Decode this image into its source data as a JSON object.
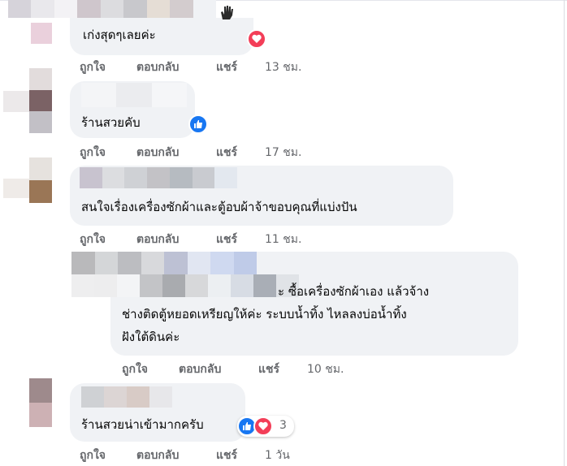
{
  "comments": [
    {
      "text": "เก่งสุดๆเลยค่ะ",
      "actions": {
        "like": "ถูกใจ",
        "reply": "ตอบกลับ",
        "share": "แชร์",
        "time": "13 ชม."
      },
      "reaction": "love-icon"
    },
    {
      "text": "ร้านสวยคับ",
      "actions": {
        "like": "ถูกใจ",
        "reply": "ตอบกลับ",
        "share": "แชร์",
        "time": "17 ชม."
      },
      "reaction": "like-icon"
    },
    {
      "text": "สนใจเรื่องเครื่องซักผ้าและตู้อบผ้าจ้าขอบคุณที่แบ่งปัน",
      "actions": {
        "like": "ถูกใจ",
        "reply": "ตอบกลับ",
        "share": "แชร์",
        "time": "11 ชม."
      }
    },
    {
      "line1": "ะ ซื้อเครื่องซักผ้าเอง แล้วจ้าง",
      "line2": "ช่างติดตู้หยอดเหรียญให้ค่ะ ระบบน้ำทิ้ง ไหลลงบ่อน้ำทิ้ง",
      "line3": "ฝังใต้ดินค่ะ",
      "actions": {
        "like": "ถูกใจ",
        "reply": "ตอบกลับ",
        "share": "แชร์",
        "time": "10 ชม."
      }
    },
    {
      "text": "ร้านสวยน่าเข้ามากครับ",
      "actions": {
        "like": "ถูกใจ",
        "reply": "ตอบกลับ",
        "share": "แชร์",
        "time": "1 วัน"
      },
      "reaction_count": "3"
    }
  ],
  "colors": {
    "bubble": "#f0f2f5",
    "meta": "#65676b",
    "like": "#1877f2",
    "love": "#f33e58"
  }
}
